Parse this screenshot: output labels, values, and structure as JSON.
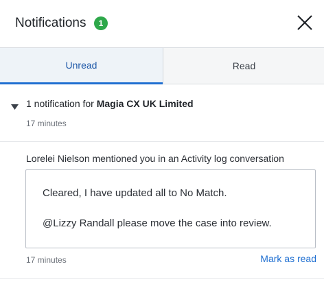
{
  "header": {
    "title": "Notifications",
    "badge_count": "1",
    "close_icon": "close-icon"
  },
  "tabs": [
    {
      "label": "Unread",
      "active": true
    },
    {
      "label": "Read",
      "active": false
    }
  ],
  "group": {
    "prefix": "1 notification for ",
    "company": "Magia CX UK Limited",
    "time": "17 minutes",
    "caret_icon": "caret-down-icon"
  },
  "notification": {
    "message": "Lorelei Nielson mentioned you in an Activity log conversation",
    "quote_line1": "Cleared, I have updated all to No Match.",
    "quote_line2": "@Lizzy Randall please move the case into review.",
    "time": "17 minutes",
    "action": "Mark as read"
  },
  "colors": {
    "accent": "#1f6fd1",
    "badge": "#2ea84a"
  }
}
